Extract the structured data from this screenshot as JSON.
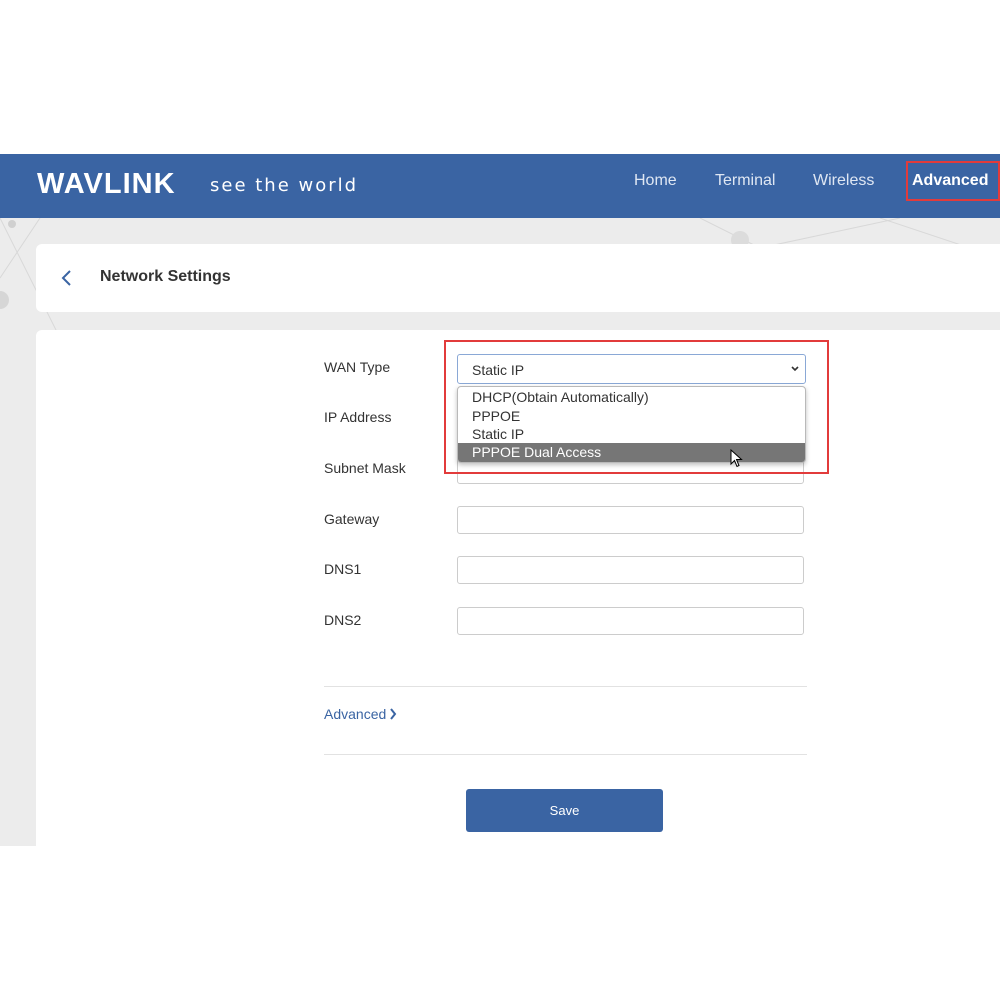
{
  "header": {
    "logo": "WAVLINK",
    "tagline": "see the world",
    "nav": [
      {
        "label": "Home"
      },
      {
        "label": "Terminal"
      },
      {
        "label": "Wireless"
      },
      {
        "label": "Advanced",
        "active": true
      }
    ]
  },
  "page": {
    "title": "Network Settings",
    "back_icon": "chevron-left-icon"
  },
  "form": {
    "wan_type": {
      "label": "WAN Type",
      "value": "Static IP",
      "options": [
        "DHCP(Obtain Automatically)",
        "PPPOE",
        "Static IP",
        "PPPOE Dual Access"
      ],
      "hovered_option": "PPPOE Dual Access"
    },
    "fields": [
      {
        "label": "IP Address",
        "value": ""
      },
      {
        "label": "Subnet Mask",
        "value": ""
      },
      {
        "label": "Gateway",
        "value": ""
      },
      {
        "label": "DNS1",
        "value": ""
      },
      {
        "label": "DNS2",
        "value": ""
      }
    ],
    "advanced_link": "Advanced",
    "save_label": "Save"
  },
  "colors": {
    "header": "#3a64a3",
    "highlight": "#e23b3b",
    "primary_button": "#3a64a3",
    "hover_option": "#767676"
  }
}
